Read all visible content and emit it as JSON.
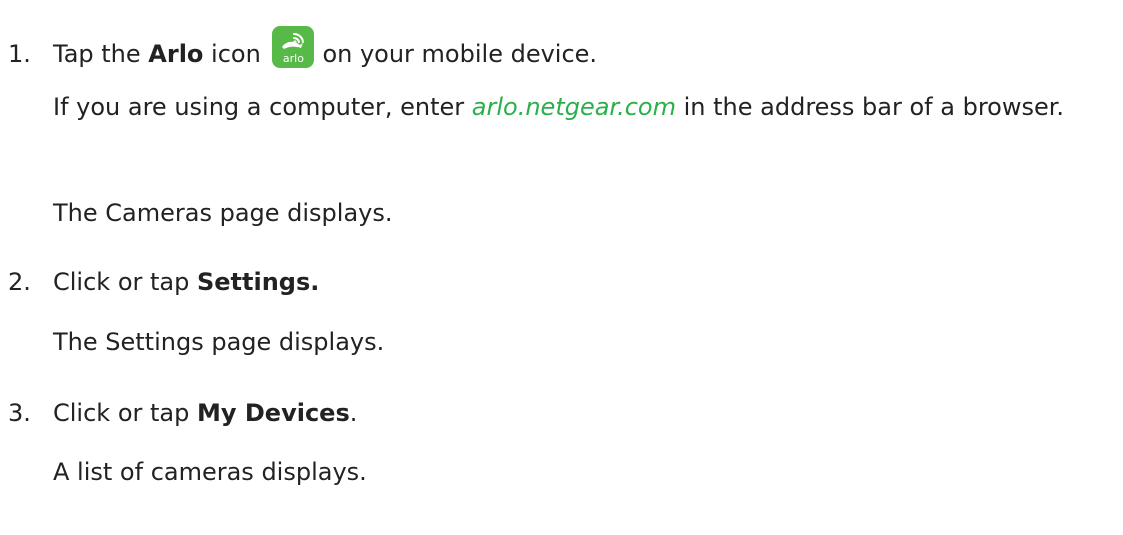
{
  "steps": [
    {
      "number": "1.",
      "before": "Tap the ",
      "bold": "Arlo",
      "after_bold": " icon",
      "after_icon": "on your mobile device.",
      "icon": {
        "name": "arlo-app-icon",
        "text": "arlo",
        "color": "#57b947"
      },
      "note": {
        "before": "If you are using a computer, enter ",
        "link": "arlo.netgear.com",
        "after": " in the address bar of a browser."
      },
      "result": "The Cameras page displays."
    },
    {
      "number": "2.",
      "before": "Click or tap ",
      "bold": "Settings.",
      "after": "",
      "result": "The Settings page displays."
    },
    {
      "number": "3.",
      "before": "Click or tap ",
      "bold": "My Devices",
      "after": ".",
      "result": "A list of cameras displays."
    }
  ],
  "colors": {
    "text": "#222222",
    "link": "#2ab04a"
  }
}
